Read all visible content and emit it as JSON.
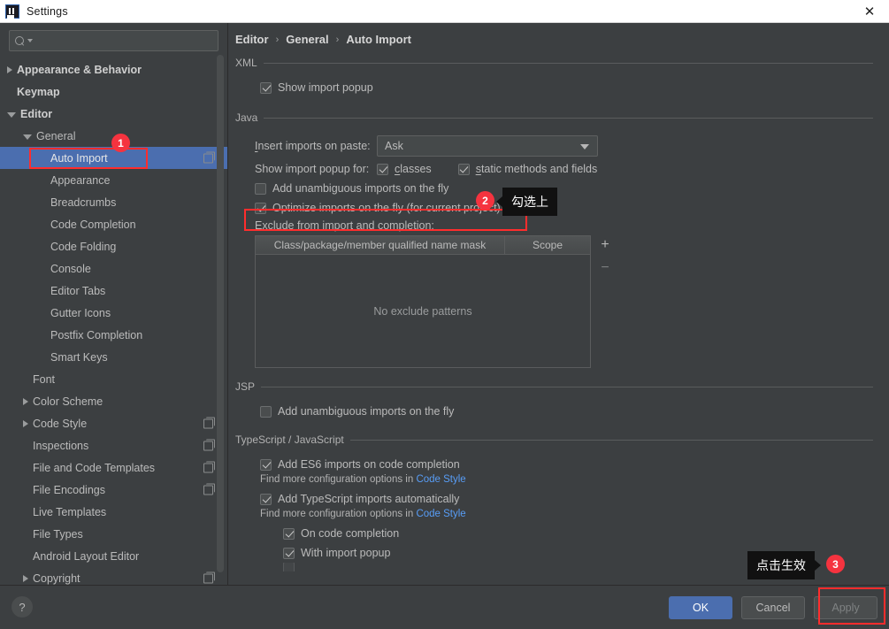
{
  "window": {
    "title": "Settings",
    "logo_icon": "intellij-idea-logo",
    "close_icon": "close-icon"
  },
  "sidebar": {
    "search": {
      "placeholder": "",
      "value": "",
      "icon": "search-icon"
    },
    "items": [
      {
        "label": "Appearance & Behavior",
        "arrow": "collapsed",
        "depth": 0,
        "bold": true,
        "selected": false,
        "copy": false
      },
      {
        "label": "Keymap",
        "arrow": "none",
        "depth": 0,
        "bold": true,
        "selected": false,
        "copy": false
      },
      {
        "label": "Editor",
        "arrow": "expanded",
        "depth": 0,
        "bold": true,
        "selected": false,
        "copy": false
      },
      {
        "label": "General",
        "arrow": "expanded",
        "depth": 1,
        "bold": false,
        "selected": false,
        "copy": false
      },
      {
        "label": "Auto Import",
        "arrow": "none",
        "depth": 2,
        "bold": false,
        "selected": true,
        "copy": true
      },
      {
        "label": "Appearance",
        "arrow": "none",
        "depth": 2,
        "bold": false,
        "selected": false,
        "copy": false
      },
      {
        "label": "Breadcrumbs",
        "arrow": "none",
        "depth": 2,
        "bold": false,
        "selected": false,
        "copy": false
      },
      {
        "label": "Code Completion",
        "arrow": "none",
        "depth": 2,
        "bold": false,
        "selected": false,
        "copy": false
      },
      {
        "label": "Code Folding",
        "arrow": "none",
        "depth": 2,
        "bold": false,
        "selected": false,
        "copy": false
      },
      {
        "label": "Console",
        "arrow": "none",
        "depth": 2,
        "bold": false,
        "selected": false,
        "copy": false
      },
      {
        "label": "Editor Tabs",
        "arrow": "none",
        "depth": 2,
        "bold": false,
        "selected": false,
        "copy": false
      },
      {
        "label": "Gutter Icons",
        "arrow": "none",
        "depth": 2,
        "bold": false,
        "selected": false,
        "copy": false
      },
      {
        "label": "Postfix Completion",
        "arrow": "none",
        "depth": 2,
        "bold": false,
        "selected": false,
        "copy": false
      },
      {
        "label": "Smart Keys",
        "arrow": "none",
        "depth": 2,
        "bold": false,
        "selected": false,
        "copy": false
      },
      {
        "label": "Font",
        "arrow": "none",
        "depth": 1,
        "bold": false,
        "selected": false,
        "copy": false
      },
      {
        "label": "Color Scheme",
        "arrow": "collapsed",
        "depth": 1,
        "bold": false,
        "selected": false,
        "copy": false
      },
      {
        "label": "Code Style",
        "arrow": "collapsed",
        "depth": 1,
        "bold": false,
        "selected": false,
        "copy": true
      },
      {
        "label": "Inspections",
        "arrow": "none",
        "depth": 1,
        "bold": false,
        "selected": false,
        "copy": true
      },
      {
        "label": "File and Code Templates",
        "arrow": "none",
        "depth": 1,
        "bold": false,
        "selected": false,
        "copy": true
      },
      {
        "label": "File Encodings",
        "arrow": "none",
        "depth": 1,
        "bold": false,
        "selected": false,
        "copy": true
      },
      {
        "label": "Live Templates",
        "arrow": "none",
        "depth": 1,
        "bold": false,
        "selected": false,
        "copy": false
      },
      {
        "label": "File Types",
        "arrow": "none",
        "depth": 1,
        "bold": false,
        "selected": false,
        "copy": false
      },
      {
        "label": "Android Layout Editor",
        "arrow": "none",
        "depth": 1,
        "bold": false,
        "selected": false,
        "copy": false
      },
      {
        "label": "Copyright",
        "arrow": "collapsed",
        "depth": 1,
        "bold": false,
        "selected": false,
        "copy": true
      }
    ]
  },
  "breadcrumb": {
    "parts": [
      "Editor",
      "General",
      "Auto Import"
    ],
    "separator": "›"
  },
  "sections": {
    "xml": {
      "title": "XML",
      "show_import_popup": {
        "label": "Show import popup",
        "checked": true
      }
    },
    "java": {
      "title": "Java",
      "insert_imports_label": "Insert imports on paste:",
      "insert_imports_value": "Ask",
      "show_popup_for_label": "Show import popup for:",
      "classes": {
        "label": "classes",
        "checked": true
      },
      "static_methods": {
        "label": "static methods and fields",
        "checked": true
      },
      "add_unambiguous": {
        "label": "Add unambiguous imports on the fly",
        "checked": false
      },
      "optimize_imports": {
        "label": "Optimize imports on the fly (for current project)",
        "checked": true
      },
      "exclude_label": "Exclude from import and completion:",
      "table": {
        "columns": [
          "Class/package/member qualified name mask",
          "Scope"
        ],
        "empty_text": "No exclude patterns",
        "add_button": "+",
        "remove_button": "−"
      }
    },
    "jsp": {
      "title": "JSP",
      "add_unambiguous": {
        "label": "Add unambiguous imports on the fly",
        "checked": false
      }
    },
    "ts": {
      "title": "TypeScript / JavaScript",
      "es6": {
        "label": "Add ES6 imports on code completion",
        "checked": true
      },
      "es6_hint_prefix": "Find more configuration options in ",
      "es6_hint_link": "Code Style",
      "ts_auto": {
        "label": "Add TypeScript imports automatically",
        "checked": true
      },
      "ts_hint_prefix": "Find more configuration options in ",
      "ts_hint_link": "Code Style",
      "on_code_completion": {
        "label": "On code completion",
        "checked": true
      },
      "with_import_popup": {
        "label": "With import popup",
        "checked": true
      }
    }
  },
  "footer": {
    "help_label": "?",
    "ok": "OK",
    "cancel": "Cancel",
    "apply": "Apply"
  },
  "annotations": [
    {
      "badge": "1",
      "tip": ""
    },
    {
      "badge": "2",
      "tip": "勾选上"
    },
    {
      "badge": "3",
      "tip": "点击生效"
    }
  ],
  "colors": {
    "accent": "#4b6eaf",
    "highlight": "#ff2d2d",
    "badge": "#f5333f",
    "link": "#589df6",
    "panel_bg": "#3c3f41"
  }
}
